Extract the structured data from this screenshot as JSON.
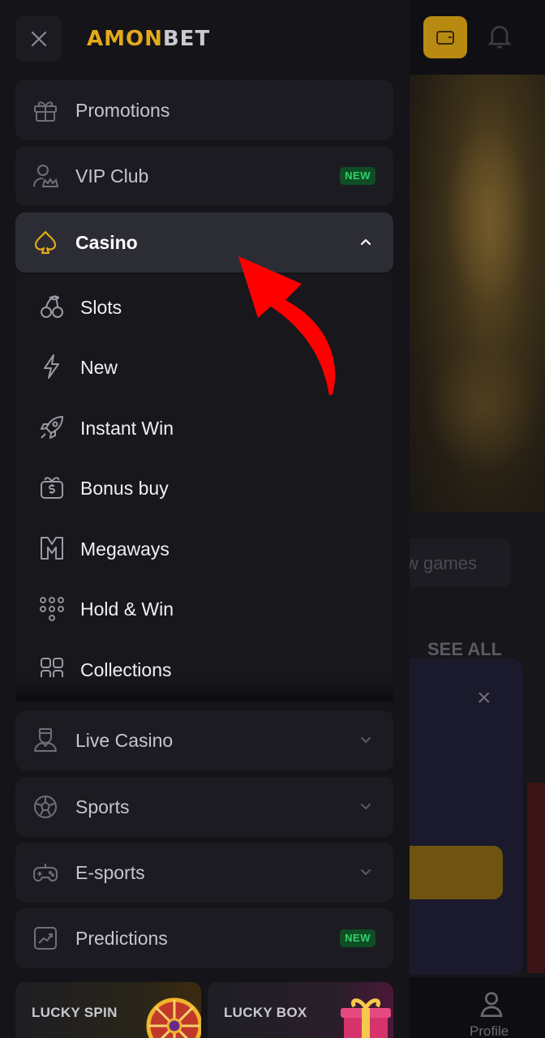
{
  "background": {
    "tab_text": "w games",
    "see_all": "SEE ALL",
    "modal_close": "×",
    "bottom_nav_profile": "Profile"
  },
  "drawer": {
    "logo": {
      "part1": "AMON",
      "part2": "BET"
    },
    "items": [
      {
        "label": "Promotions",
        "icon": "gift-icon"
      },
      {
        "label": "VIP Club",
        "icon": "vip-user-icon",
        "badge": "NEW"
      },
      {
        "label": "Casino",
        "icon": "spade-icon",
        "expanded": true
      },
      {
        "label": "Live Casino",
        "icon": "dealer-icon"
      },
      {
        "label": "Sports",
        "icon": "soccer-ball-icon"
      },
      {
        "label": "E-sports",
        "icon": "gamepad-icon"
      },
      {
        "label": "Predictions",
        "icon": "chart-icon",
        "badge": "NEW"
      }
    ],
    "casino_submenu": [
      {
        "label": "Slots",
        "icon": "cherries-icon"
      },
      {
        "label": "New",
        "icon": "lightning-icon"
      },
      {
        "label": "Instant Win",
        "icon": "rocket-icon"
      },
      {
        "label": "Bonus buy",
        "icon": "dollar-gift-icon"
      },
      {
        "label": "Megaways",
        "icon": "megaways-icon"
      },
      {
        "label": "Hold & Win",
        "icon": "dots-grid-icon"
      },
      {
        "label": "Collections",
        "icon": "collections-icon"
      }
    ],
    "promo_cards": [
      {
        "label": "LUCKY SPIN"
      },
      {
        "label": "LUCKY BOX"
      }
    ]
  },
  "colors": {
    "accent": "#e3a91a",
    "badge_bg": "#0f4e25",
    "badge_text": "#35d06a",
    "annotation_arrow": "#ff0000"
  }
}
